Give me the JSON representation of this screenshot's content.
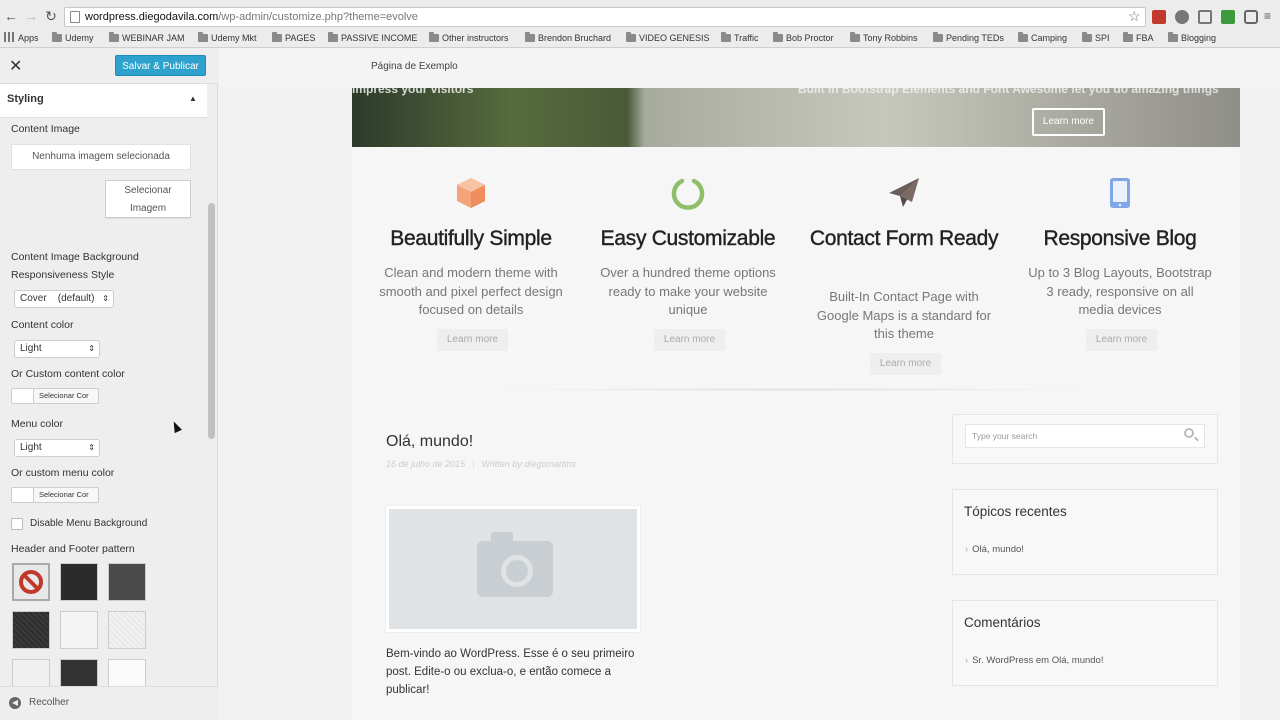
{
  "browser": {
    "url_host": "wordpress.diegodavila.com",
    "url_path": "/wp-admin/customize.php?theme=evolve",
    "bookmarks": [
      "Apps",
      "Udemy",
      "WEBINAR JAM",
      "Udemy Mkt",
      "PAGES",
      "PASSIVE INCOME",
      "Other instructors",
      "Brendon Bruchard",
      "VIDEO GENESIS",
      "Traffic",
      "Bob Proctor",
      "Tony Robbins",
      "Pending TEDs",
      "Camping",
      "SPI",
      "FBA",
      "Blogging"
    ]
  },
  "panel": {
    "close_icon": "close-icon",
    "save_label": "Salvar & Publicar",
    "section_title": "Styling",
    "content_image_label": "Content Image",
    "no_image_text": "Nenhuma imagem selecionada",
    "select_image_label": "Selecionar Imagem",
    "bg_style_label": "Content Image Background Responsiveness Style",
    "bg_style_value": "Cover    (default)",
    "content_color_label": "Content color",
    "content_color_value": "Light",
    "custom_content_color_label": "Or Custom content color",
    "select_color_label": "Selecionar Cor",
    "menu_color_label": "Menu color",
    "menu_color_value": "Light",
    "custom_menu_color_label": "Or custom menu color",
    "disable_menu_bg_label": "Disable Menu Background",
    "pattern_label": "Header and Footer pattern",
    "collapse_label": "Recolher"
  },
  "preview": {
    "page_title": "Página de Exemplo",
    "hero_left_text": "impress your visitors",
    "hero_right_text": "Built In Bootstrap Elements and Font Awesome let you do amazing things",
    "hero_button": "Learn more",
    "features": [
      {
        "title": "Beautifully Simple",
        "text": "Clean and modern theme with smooth and pixel perfect design focused on details",
        "button": "Learn more",
        "icon": "cube-icon",
        "color": "#f5a47a"
      },
      {
        "title": "Easy Customizable",
        "text": "Over a hundred theme options ready to make your website unique",
        "button": "Learn more",
        "icon": "circle-notch-icon",
        "color": "#8fbf6a"
      },
      {
        "title": "Contact Form Ready",
        "text": "Built-In Contact Page with Google Maps is a standard for this theme",
        "button": "Learn more",
        "icon": "paper-plane-icon",
        "color": "#6b5d58"
      },
      {
        "title": "Responsive Blog",
        "text": "Up to 3 Blog Layouts, Bootstrap 3 ready, responsive on all media devices",
        "button": "Learn more",
        "icon": "tablet-icon",
        "color": "#7fa6e6"
      }
    ],
    "post": {
      "title": "Olá, mundo!",
      "date": "16 de julho de 2015",
      "author": "Written by diegomartins",
      "body": "Bem-vindo ao WordPress. Esse é o seu primeiro post. Edite-o ou exclua-o, e então comece a publicar!"
    },
    "search_placeholder": "Type your search",
    "recent_title": "Tópicos recentes",
    "recent_item": "Olá, mundo!",
    "comments_title": "Comentários",
    "comment_author": "Sr. WordPress",
    "comment_on": "em",
    "comment_post": "Olá, mundo!"
  }
}
